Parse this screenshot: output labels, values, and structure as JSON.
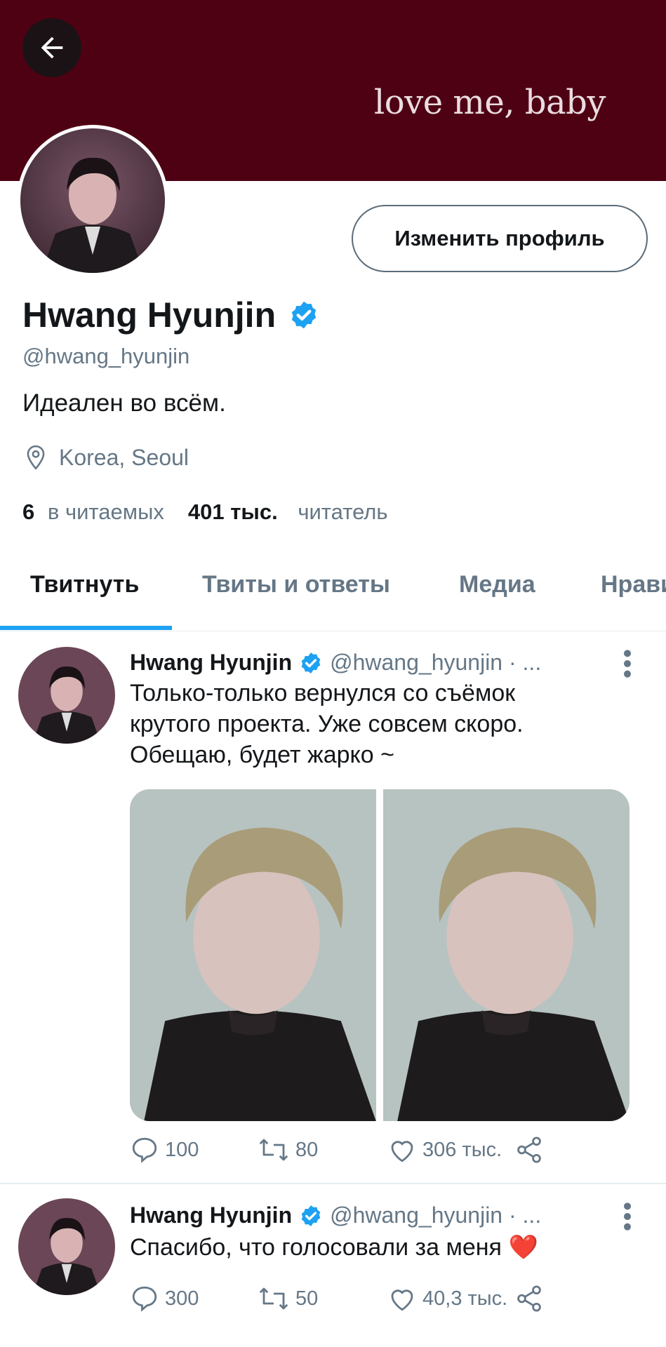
{
  "banner": {
    "text": "love me, baby",
    "color": "#4f0114"
  },
  "profile": {
    "edit_button": "Изменить профиль",
    "name": "Hwang Hyunjin",
    "handle": "@hwang_hyunjin",
    "bio": "Идеален во всём.",
    "location": "Korea, Seoul",
    "following_count": "6",
    "following_label": "в читаемых",
    "followers_count": "401 тыс.",
    "followers_label": "читатель"
  },
  "tabs": [
    {
      "label": "Твитнуть",
      "active": true
    },
    {
      "label": "Твиты и ответы",
      "active": false
    },
    {
      "label": "Медиа",
      "active": false
    },
    {
      "label": "Нравится",
      "active": false
    }
  ],
  "tweets": [
    {
      "name": "Hwang Hyunjin",
      "handle": "@hwang_hyunjin · ...",
      "text_lines": [
        "Только-только вернулся со съёмок",
        "крутого проекта. Уже совсем скоро.",
        "Обещаю, будет жарко ~"
      ],
      "replies": "100",
      "retweets": "80",
      "likes": "306 тыс."
    },
    {
      "name": "Hwang Hyunjin",
      "handle": "@hwang_hyunjin · ...",
      "text": "Спасибо, что голосовали за меня",
      "emoji": "❤️",
      "replies": "300",
      "retweets": "50",
      "likes": "40,3 тыс."
    }
  ],
  "icons": {
    "back": "arrow-left-icon",
    "verified": "verified-badge-icon",
    "location": "location-pin-icon",
    "reply": "reply-icon",
    "retweet": "retweet-icon",
    "like": "heart-icon",
    "share": "share-icon",
    "more": "more-vertical-icon"
  },
  "colors": {
    "accent": "#1da1f2",
    "muted": "#657786",
    "text": "#14171a"
  }
}
